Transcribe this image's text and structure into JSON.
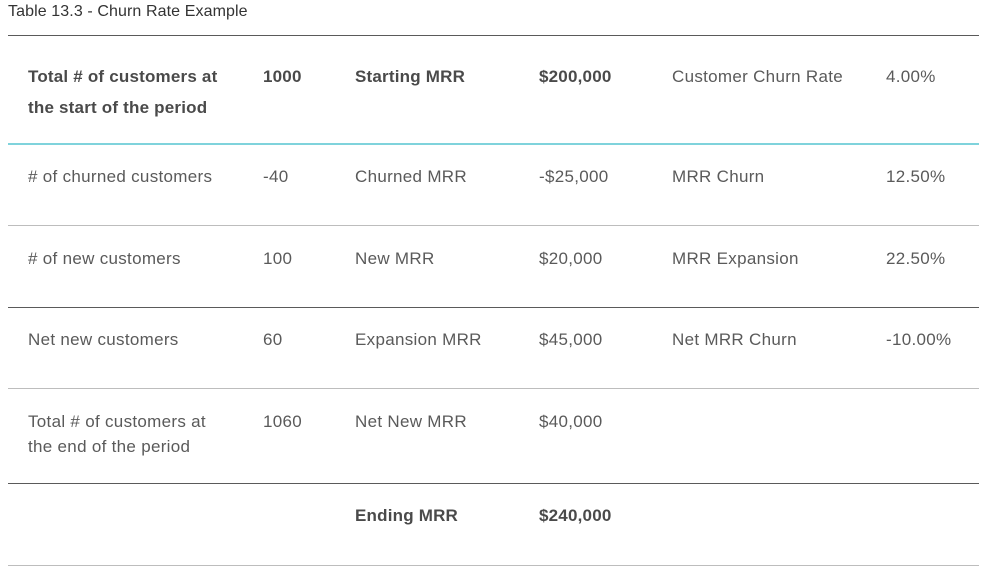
{
  "caption": "Table 13.3 - Churn Rate Example",
  "header": {
    "customers_label": "Total # of customers at the start of the period",
    "customers_value": "1000",
    "mrr_label": "Starting MRR",
    "mrr_value": "$200,000",
    "metric_label": "Customer Churn Rate",
    "metric_value": "4.00%"
  },
  "rows": [
    {
      "customers_label": "# of churned customers",
      "customers_value": "-40",
      "mrr_label": "Churned MRR",
      "mrr_value": "-$25,000",
      "metric_label": "MRR Churn",
      "metric_value": "12.50%"
    },
    {
      "customers_label": "# of new customers",
      "customers_value": "100",
      "mrr_label": "New MRR",
      "mrr_value": "$20,000",
      "metric_label": "MRR Expansion",
      "metric_value": "22.50%"
    },
    {
      "customers_label": "Net new customers",
      "customers_value": "60",
      "mrr_label": "Expansion MRR",
      "mrr_value": "$45,000",
      "metric_label": "Net MRR Churn",
      "metric_value": "-10.00%"
    },
    {
      "customers_label": "Total # of customers at the end of the period",
      "customers_value": "1060",
      "mrr_label": "Net New MRR",
      "mrr_value": "$40,000",
      "metric_label": "",
      "metric_value": ""
    }
  ],
  "footer": {
    "mrr_label": "Ending MRR",
    "mrr_value": "$240,000"
  }
}
